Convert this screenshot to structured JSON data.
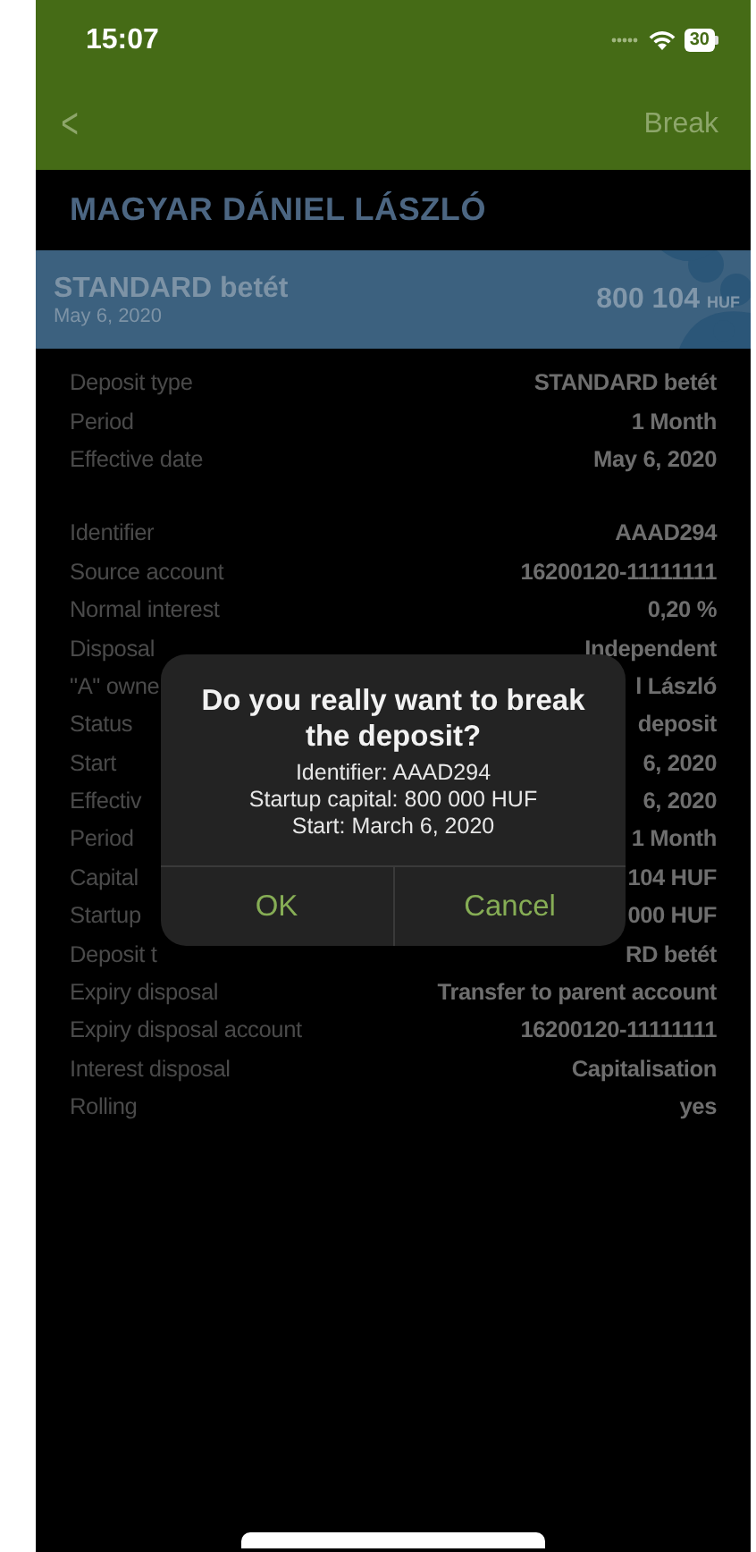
{
  "status_bar": {
    "time": "15:07",
    "battery": "30"
  },
  "nav_bar": {
    "back": "<",
    "action": "Break"
  },
  "owner": "MAGYAR DÁNIEL LÁSZLÓ",
  "deposit_card": {
    "name": "STANDARD betét",
    "date": "May 6, 2020",
    "amount": "800 104",
    "currency": "HUF"
  },
  "sections": [
    {
      "rows": [
        {
          "label": "Deposit type",
          "value": "STANDARD betét"
        },
        {
          "label": "Period",
          "value": "1 Month"
        },
        {
          "label": "Effective date",
          "value": "May 6, 2020"
        }
      ]
    },
    {
      "rows": [
        {
          "label": "Identifier",
          "value": "AAAD294"
        },
        {
          "label": "Source account",
          "value": "16200120-11111111"
        },
        {
          "label": "Normal interest",
          "value": "0,20 %"
        },
        {
          "label": "Disposal",
          "value": "Independent"
        },
        {
          "label": "\"A\" owne",
          "value": "l László"
        },
        {
          "label": "Status",
          "value": "deposit"
        },
        {
          "label": "Start",
          "value": "6, 2020"
        },
        {
          "label": "Effectiv",
          "value": "6, 2020"
        },
        {
          "label": "Period",
          "value": "1 Month"
        },
        {
          "label": "Capital",
          "value": "104 HUF"
        },
        {
          "label": "Startup",
          "value": "000 HUF"
        },
        {
          "label": "Deposit t",
          "value": "RD betét"
        },
        {
          "label": "Expiry disposal",
          "value": "Transfer to parent account"
        },
        {
          "label": "Expiry disposal account",
          "value": "16200120-11111111"
        },
        {
          "label": "Interest disposal",
          "value": "Capitalisation"
        },
        {
          "label": "Rolling",
          "value": "yes"
        }
      ]
    }
  ],
  "dialog": {
    "title": "Do you really want to break the deposit?",
    "lines": [
      "Identifier: AAAD294",
      "Startup capital: 800 000 HUF",
      "Start: March 6, 2020"
    ],
    "buttons": [
      "OK",
      "Cancel"
    ]
  }
}
